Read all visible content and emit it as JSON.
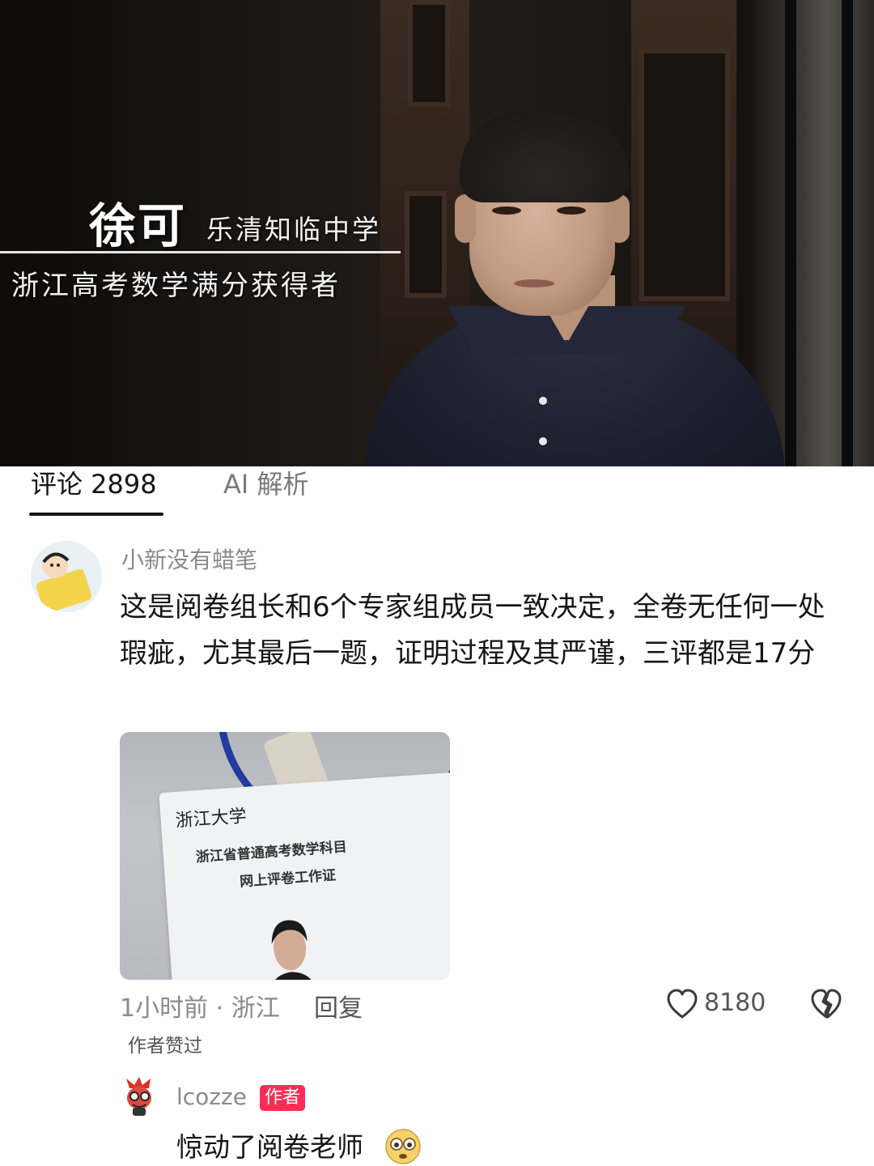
{
  "video": {
    "name": "徐可",
    "school": "乐清知临中学",
    "title": "浙江高考数学满分获得者"
  },
  "tabs": {
    "comments": "评论 2898",
    "ai": "AI 解析"
  },
  "comment": {
    "username": "小新没有蜡笔",
    "text": "这是阅卷组长和6个专家组成员一致决定，全卷无任何一处瑕疵，尤其最后一题，证明过程及其严谨，三评都是17分",
    "photo_card": {
      "logo": "浙江大学",
      "line1": "浙江省普通高考数学科目",
      "line2": "网上评卷工作证"
    },
    "time_location": "1小时前 · 浙江",
    "reply_label": "回复",
    "likes": "8180",
    "author_liked": "作者赞过"
  },
  "reply": {
    "username": "lcozze",
    "badge": "作者",
    "text": "惊动了阅卷老师"
  },
  "colors": {
    "accent": "#fe2c55",
    "muted_text": "#8a8a8a",
    "primary_text": "#161616"
  }
}
